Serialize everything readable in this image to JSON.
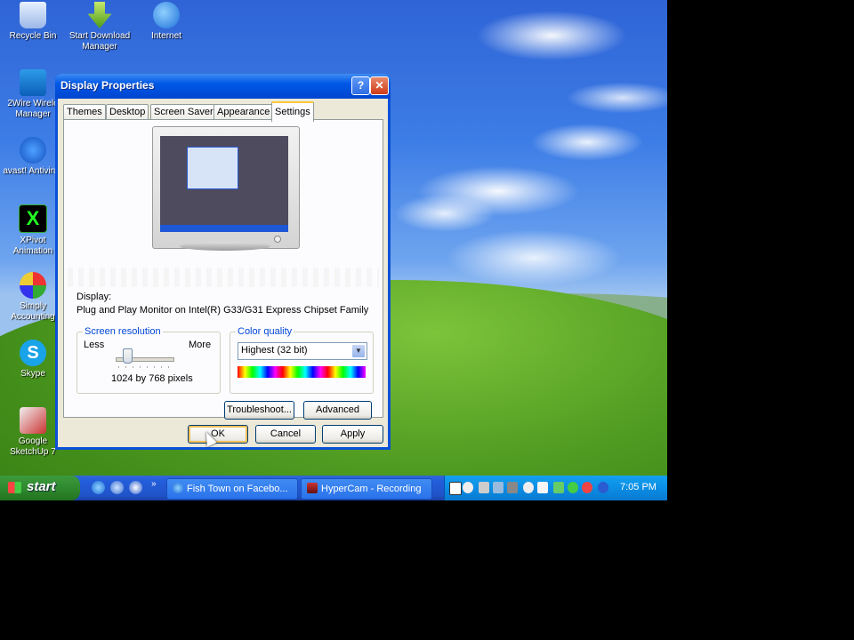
{
  "desktop": {
    "icons": [
      {
        "label": "Recycle Bin",
        "icon": "recycle-bin-icon"
      },
      {
        "label": "Start Download Manager",
        "icon": "download-manager-icon"
      },
      {
        "label": "Internet",
        "icon": "internet-explorer-icon"
      },
      {
        "label": "2Wire Wirele Manager",
        "icon": "wireless-icon"
      },
      {
        "label": "avast! Antivirus",
        "icon": "avast-icon"
      },
      {
        "label": "XPivot Animation",
        "icon": "xpivot-icon"
      },
      {
        "label": "Simply Accounting",
        "icon": "simply-accounting-icon"
      },
      {
        "label": "Skype",
        "icon": "skype-icon"
      },
      {
        "label": "Google SketchUp 7",
        "icon": "sketchup-icon"
      }
    ]
  },
  "window": {
    "title": "Display Properties",
    "help_glyph": "?",
    "close_glyph": "✕",
    "tabs": [
      {
        "label": "Themes"
      },
      {
        "label": "Desktop"
      },
      {
        "label": "Screen Saver"
      },
      {
        "label": "Appearance"
      },
      {
        "label": "Settings",
        "selected": true
      }
    ],
    "display_label": "Display:",
    "display_value": "Plug and Play Monitor on Intel(R) G33/G31 Express Chipset Family",
    "resolution": {
      "title": "Screen resolution",
      "less": "Less",
      "more": "More",
      "value": "1024 by 768 pixels",
      "slider_fraction": 0.2
    },
    "color_quality": {
      "title": "Color quality",
      "selected": "Highest (32 bit)"
    },
    "buttons": {
      "troubleshoot": "Troubleshoot...",
      "advanced": "Advanced",
      "ok": "OK",
      "cancel": "Cancel",
      "apply": "Apply"
    }
  },
  "taskbar": {
    "start_label": "start",
    "quick_launch_more": "»",
    "tasks": [
      {
        "label": "Fish Town on Facebo..."
      },
      {
        "label": "HyperCam - Recording"
      }
    ],
    "clock": "7:05 PM"
  },
  "colors": {
    "xp_blue": "#0058e6",
    "start_green": "#2f8a2f",
    "group_title": "#0046d5",
    "dialog_bg": "#ece9d8"
  }
}
